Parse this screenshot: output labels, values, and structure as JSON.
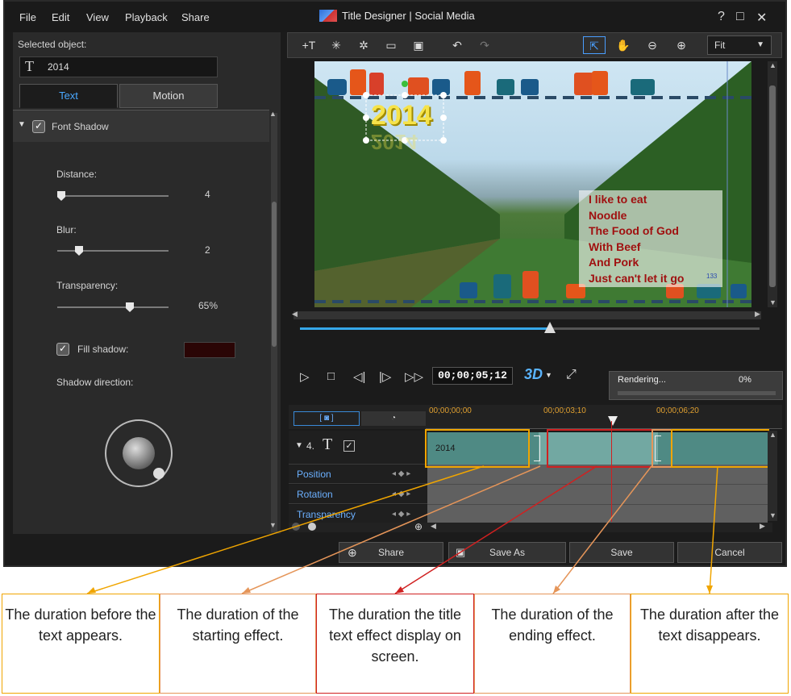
{
  "menu": [
    "File",
    "Edit",
    "View",
    "Playback",
    "Share"
  ],
  "window": {
    "title": "Title Designer | Social Media",
    "controls": [
      "?",
      "□",
      "✕"
    ]
  },
  "selected_object": {
    "label": "Selected object:",
    "value": "2014"
  },
  "tabs": [
    "Text",
    "Motion"
  ],
  "section": {
    "label": "Font Shadow"
  },
  "shadow": {
    "distance": {
      "label": "Distance:",
      "value": "4"
    },
    "blur": {
      "label": "Blur:",
      "value": "2"
    },
    "transparency": {
      "label": "Transparency:",
      "value": "65%"
    },
    "fill_shadow": {
      "label": "Fill shadow:",
      "color": "#2a0505"
    },
    "direction": {
      "label": "Shadow direction:"
    }
  },
  "toolbar": {
    "fit": "Fit"
  },
  "preview": {
    "year_text": "2014",
    "lines": [
      "I like to eat",
      "Noodle",
      "The Food of God",
      "With Beef",
      "And Pork",
      "Just can't let it go"
    ],
    "marker": "133"
  },
  "playback": {
    "timecode": "00;00;05;12",
    "threed": "3D"
  },
  "render": {
    "label": "Rendering...",
    "percent": "0%"
  },
  "timeline": {
    "ticks": [
      "00;00;00;00",
      "00;00;03;10",
      "00;00;06;20"
    ],
    "track_num": "4.",
    "clip_label": "2014",
    "rows": [
      "Position",
      "Rotation",
      "Transparency"
    ]
  },
  "buttons": {
    "share": "Share",
    "save_as": "Save As",
    "save": "Save",
    "cancel": "Cancel"
  },
  "annotations": [
    "The duration before the text appears.",
    "The duration of the starting effect.",
    "The duration the title text effect display on screen.",
    "The duration of the ending effect.",
    "The duration after the text disappears."
  ],
  "colors": {
    "accent": "#4aa8ff",
    "highlight_yellow": "#f0a500",
    "highlight_red": "#d02020",
    "highlight_orange": "#e59559"
  }
}
